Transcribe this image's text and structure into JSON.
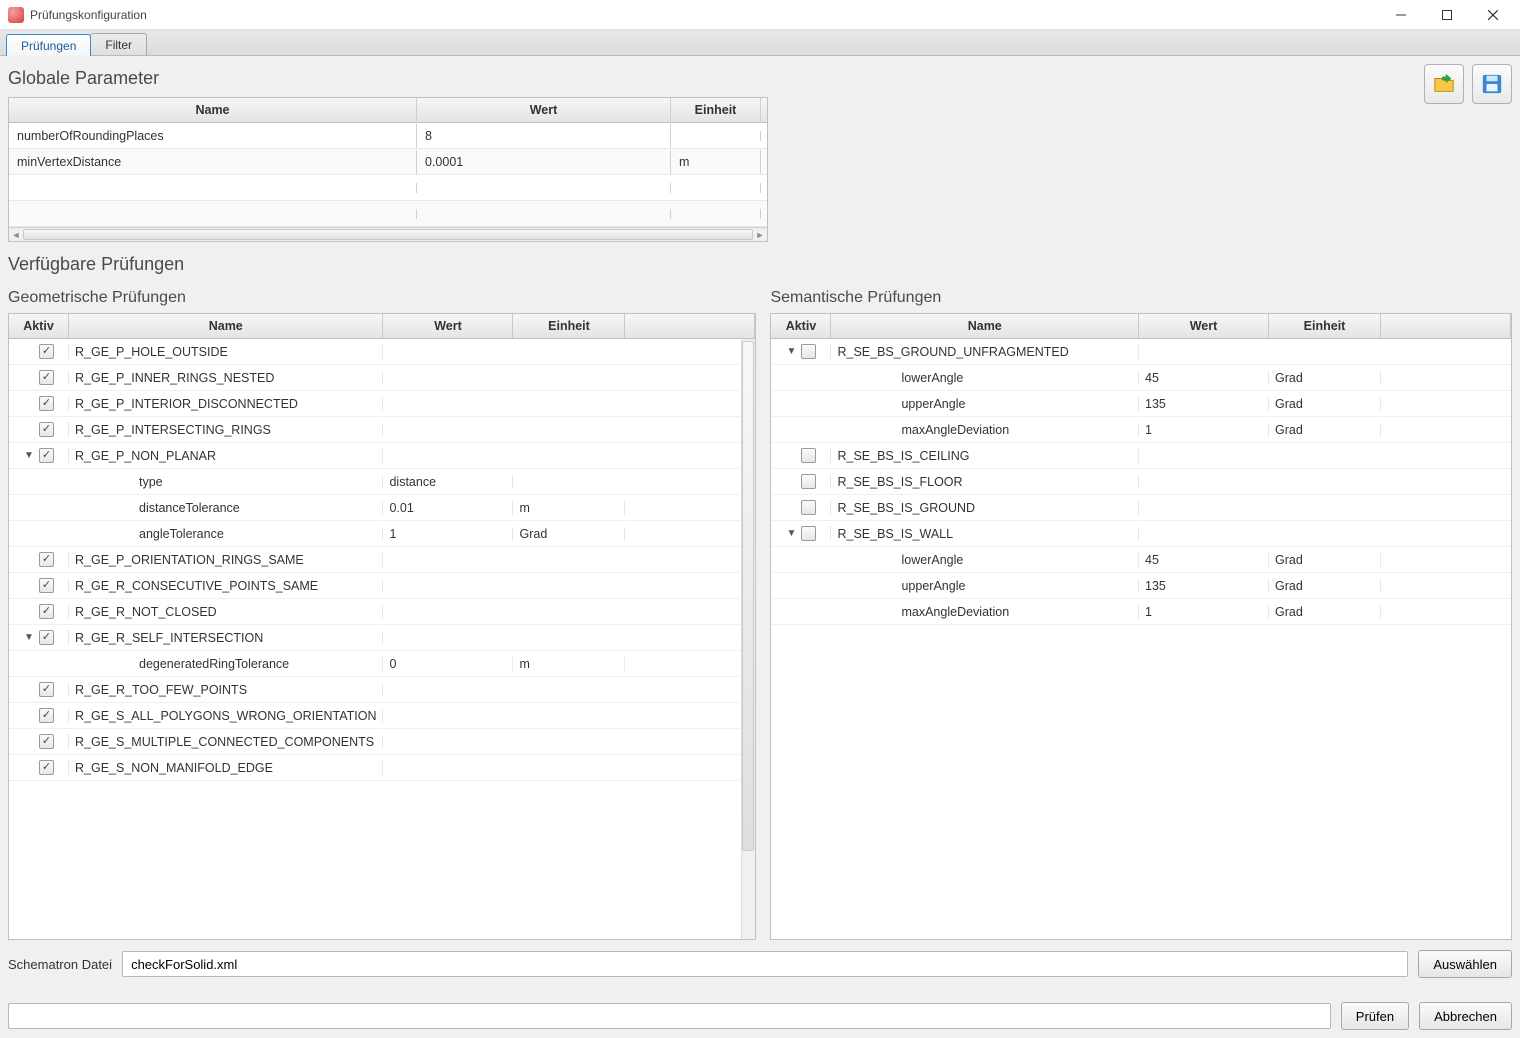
{
  "window": {
    "title": "Prüfungskonfiguration"
  },
  "tabs": [
    {
      "label": "Prüfungen",
      "active": true
    },
    {
      "label": "Filter",
      "active": false
    }
  ],
  "toolbarIcons": {
    "open": "folder-open-icon",
    "save": "save-icon"
  },
  "globalParams": {
    "heading": "Globale Parameter",
    "columns": {
      "name": "Name",
      "value": "Wert",
      "unit": "Einheit"
    },
    "rows": [
      {
        "name": "numberOfRoundingPlaces",
        "value": "8",
        "unit": ""
      },
      {
        "name": "minVertexDistance",
        "value": "0.0001",
        "unit": "m"
      }
    ]
  },
  "available": {
    "heading": "Verfügbare Prüfungen"
  },
  "treeColumns": {
    "active": "Aktiv",
    "name": "Name",
    "value": "Wert",
    "unit": "Einheit"
  },
  "geom": {
    "heading": "Geometrische Prüfungen",
    "rows": [
      {
        "type": "check",
        "checked": true,
        "name": "R_GE_P_HOLE_OUTSIDE"
      },
      {
        "type": "check",
        "checked": true,
        "name": "R_GE_P_INNER_RINGS_NESTED"
      },
      {
        "type": "check",
        "checked": true,
        "name": "R_GE_P_INTERIOR_DISCONNECTED"
      },
      {
        "type": "check",
        "checked": true,
        "name": "R_GE_P_INTERSECTING_RINGS"
      },
      {
        "type": "parent",
        "checked": true,
        "expanded": true,
        "name": "R_GE_P_NON_PLANAR"
      },
      {
        "type": "param",
        "name": "type",
        "value": "distance",
        "unit": ""
      },
      {
        "type": "param",
        "name": "distanceTolerance",
        "value": "0.01",
        "unit": "m"
      },
      {
        "type": "param",
        "name": "angleTolerance",
        "value": "1",
        "unit": "Grad"
      },
      {
        "type": "check",
        "checked": true,
        "name": "R_GE_P_ORIENTATION_RINGS_SAME"
      },
      {
        "type": "check",
        "checked": true,
        "name": "R_GE_R_CONSECUTIVE_POINTS_SAME"
      },
      {
        "type": "check",
        "checked": true,
        "name": "R_GE_R_NOT_CLOSED"
      },
      {
        "type": "parent",
        "checked": true,
        "expanded": true,
        "name": "R_GE_R_SELF_INTERSECTION"
      },
      {
        "type": "param",
        "name": "degeneratedRingTolerance",
        "value": "0",
        "unit": "m"
      },
      {
        "type": "check",
        "checked": true,
        "name": "R_GE_R_TOO_FEW_POINTS"
      },
      {
        "type": "check",
        "checked": true,
        "name": "R_GE_S_ALL_POLYGONS_WRONG_ORIENTATION"
      },
      {
        "type": "check",
        "checked": true,
        "name": "R_GE_S_MULTIPLE_CONNECTED_COMPONENTS"
      },
      {
        "type": "check",
        "checked": true,
        "name": "R_GE_S_NON_MANIFOLD_EDGE"
      }
    ]
  },
  "sem": {
    "heading": "Semantische Prüfungen",
    "rows": [
      {
        "type": "parent",
        "checked": false,
        "expanded": true,
        "name": "R_SE_BS_GROUND_UNFRAGMENTED"
      },
      {
        "type": "param",
        "name": "lowerAngle",
        "value": "45",
        "unit": "Grad"
      },
      {
        "type": "param",
        "name": "upperAngle",
        "value": "135",
        "unit": "Grad"
      },
      {
        "type": "param",
        "name": "maxAngleDeviation",
        "value": "1",
        "unit": "Grad"
      },
      {
        "type": "check",
        "checked": false,
        "name": "R_SE_BS_IS_CEILING"
      },
      {
        "type": "check",
        "checked": false,
        "name": "R_SE_BS_IS_FLOOR"
      },
      {
        "type": "check",
        "checked": false,
        "name": "R_SE_BS_IS_GROUND"
      },
      {
        "type": "parent",
        "checked": false,
        "expanded": true,
        "name": "R_SE_BS_IS_WALL"
      },
      {
        "type": "param",
        "name": "lowerAngle",
        "value": "45",
        "unit": "Grad"
      },
      {
        "type": "param",
        "name": "upperAngle",
        "value": "135",
        "unit": "Grad"
      },
      {
        "type": "param",
        "name": "maxAngleDeviation",
        "value": "1",
        "unit": "Grad"
      }
    ]
  },
  "schematron": {
    "label": "Schematron Datei",
    "value": "checkForSolid.xml",
    "chooseLabel": "Auswählen"
  },
  "footer": {
    "runLabel": "Prüfen",
    "cancelLabel": "Abbrechen"
  }
}
